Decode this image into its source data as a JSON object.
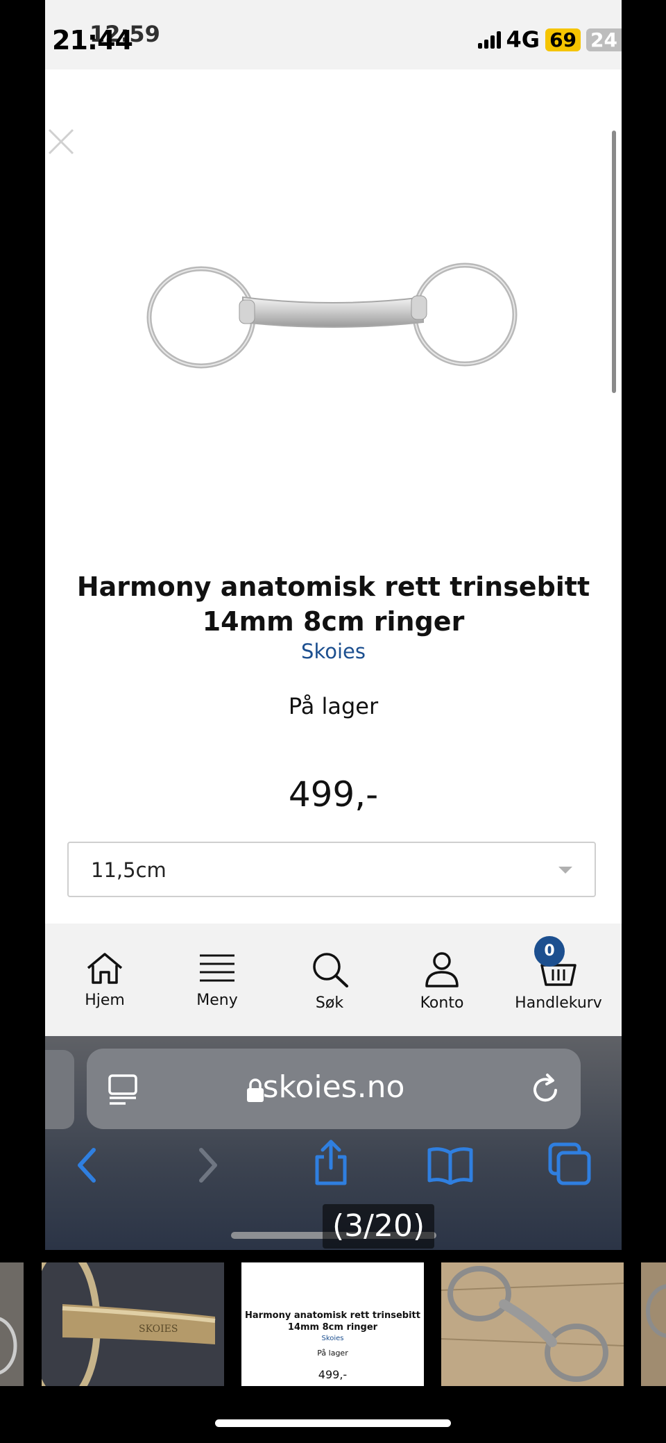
{
  "status_bar": {
    "time": "21:44",
    "time_overlay": "12:59",
    "network": "4G",
    "battery": "69",
    "battery_overlay": "24"
  },
  "product": {
    "title": "Harmony anatomisk rett trinsebitt 14mm 8cm ringer",
    "brand": "Skoies",
    "stock": "På lager",
    "price": "499,-",
    "size_select": {
      "value": "11,5cm"
    }
  },
  "bottom_nav": {
    "items": [
      {
        "label": "Hjem",
        "icon": "home-icon"
      },
      {
        "label": "Meny",
        "icon": "menu-icon"
      },
      {
        "label": "Søk",
        "icon": "search-icon"
      },
      {
        "label": "Konto",
        "icon": "account-icon"
      },
      {
        "label": "Handlekurv",
        "icon": "basket-icon"
      }
    ],
    "cart_count": "0"
  },
  "browser": {
    "url": "skoies.no"
  },
  "gallery": {
    "counter": "(3/20)",
    "thumb_brand_text": "SKOIES",
    "thumb_product": {
      "title": "Harmony anatomisk rett trinsebitt 14mm 8cm ringer",
      "brand": "Skoies",
      "stock": "På lager",
      "price": "499,-"
    }
  },
  "colors": {
    "brand_blue": "#1c4f8f",
    "safari_blue": "#2f7fe0",
    "nav_background": "#f2f2f2"
  }
}
